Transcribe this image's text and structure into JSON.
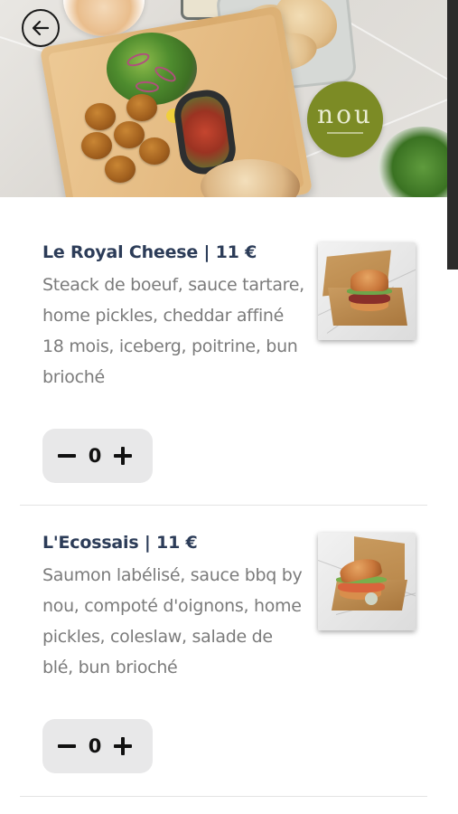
{
  "header": {
    "back_button_icon": "arrow-left-icon",
    "logo_text": "nou"
  },
  "menu_items": [
    {
      "title": "Le Royal Cheese | 11 €",
      "description": "Steack de boeuf, sauce tartare, home pickles, cheddar affiné 18 mois, iceberg, poitrine, bun brioché",
      "quantity": "0",
      "photo_icon": "burger-box-photo"
    },
    {
      "title": "L'Ecossais | 11 €",
      "description": "Saumon labélisé, sauce bbq by nou, compoté d'oignons, home pickles, coleslaw, salade de blé, bun brioché",
      "quantity": "0",
      "photo_icon": "salmon-burger-box-photo"
    }
  ],
  "stepper_icons": {
    "decrement": "minus-icon",
    "increment": "plus-icon"
  },
  "colors": {
    "title": "#2c3c58",
    "description": "#7b7b7b",
    "stepper_bg": "#e8e8e9",
    "logo_bg": "#7c8b25",
    "scrollbar": "#2b2b2b"
  }
}
